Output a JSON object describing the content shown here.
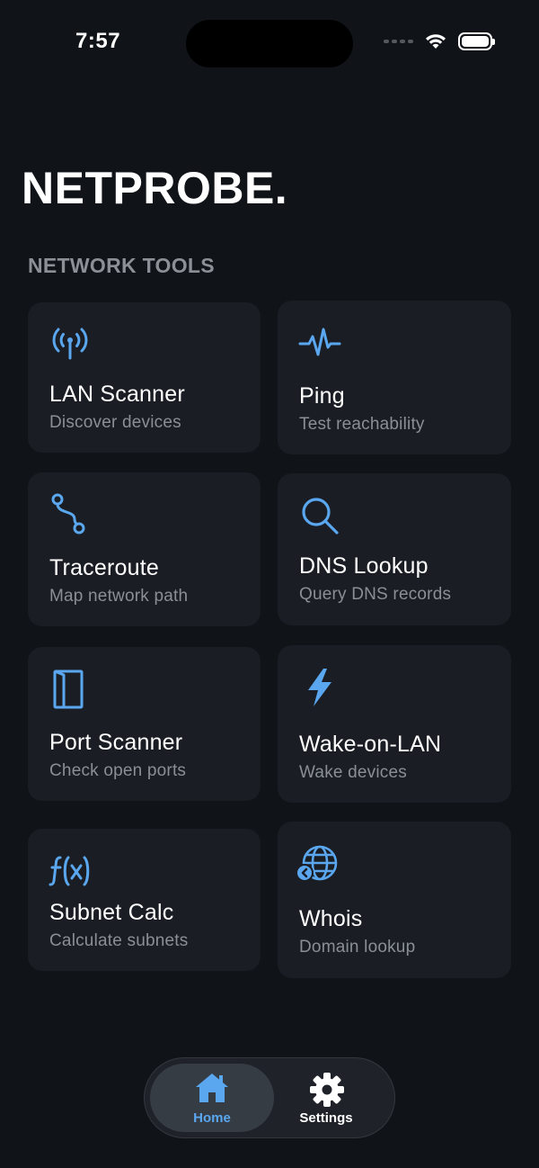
{
  "status_bar": {
    "time": "7:57"
  },
  "header": {
    "title": "NETPROBE."
  },
  "section": {
    "title": "NETWORK TOOLS"
  },
  "tools": [
    {
      "title": "LAN Scanner",
      "subtitle": "Discover devices",
      "icon": "antenna-icon"
    },
    {
      "title": "Ping",
      "subtitle": "Test reachability",
      "icon": "pulse-icon"
    },
    {
      "title": "Traceroute",
      "subtitle": "Map network path",
      "icon": "route-icon"
    },
    {
      "title": "DNS Lookup",
      "subtitle": "Query DNS records",
      "icon": "search-icon"
    },
    {
      "title": "Port Scanner",
      "subtitle": "Check open ports",
      "icon": "door-icon"
    },
    {
      "title": "Wake-on-LAN",
      "subtitle": "Wake devices",
      "icon": "bolt-icon"
    },
    {
      "title": "Subnet Calc",
      "subtitle": "Calculate subnets",
      "icon": "function-icon"
    },
    {
      "title": "Whois",
      "subtitle": "Domain lookup",
      "icon": "globe-icon"
    }
  ],
  "tab_bar": {
    "tabs": [
      {
        "label": "Home",
        "icon": "house-icon",
        "active": true
      },
      {
        "label": "Settings",
        "icon": "gear-icon",
        "active": false
      }
    ]
  },
  "colors": {
    "accent": "#5aa7f0",
    "background": "#101318",
    "tile": "#1a1e24",
    "muted_text": "#8a8f96"
  }
}
